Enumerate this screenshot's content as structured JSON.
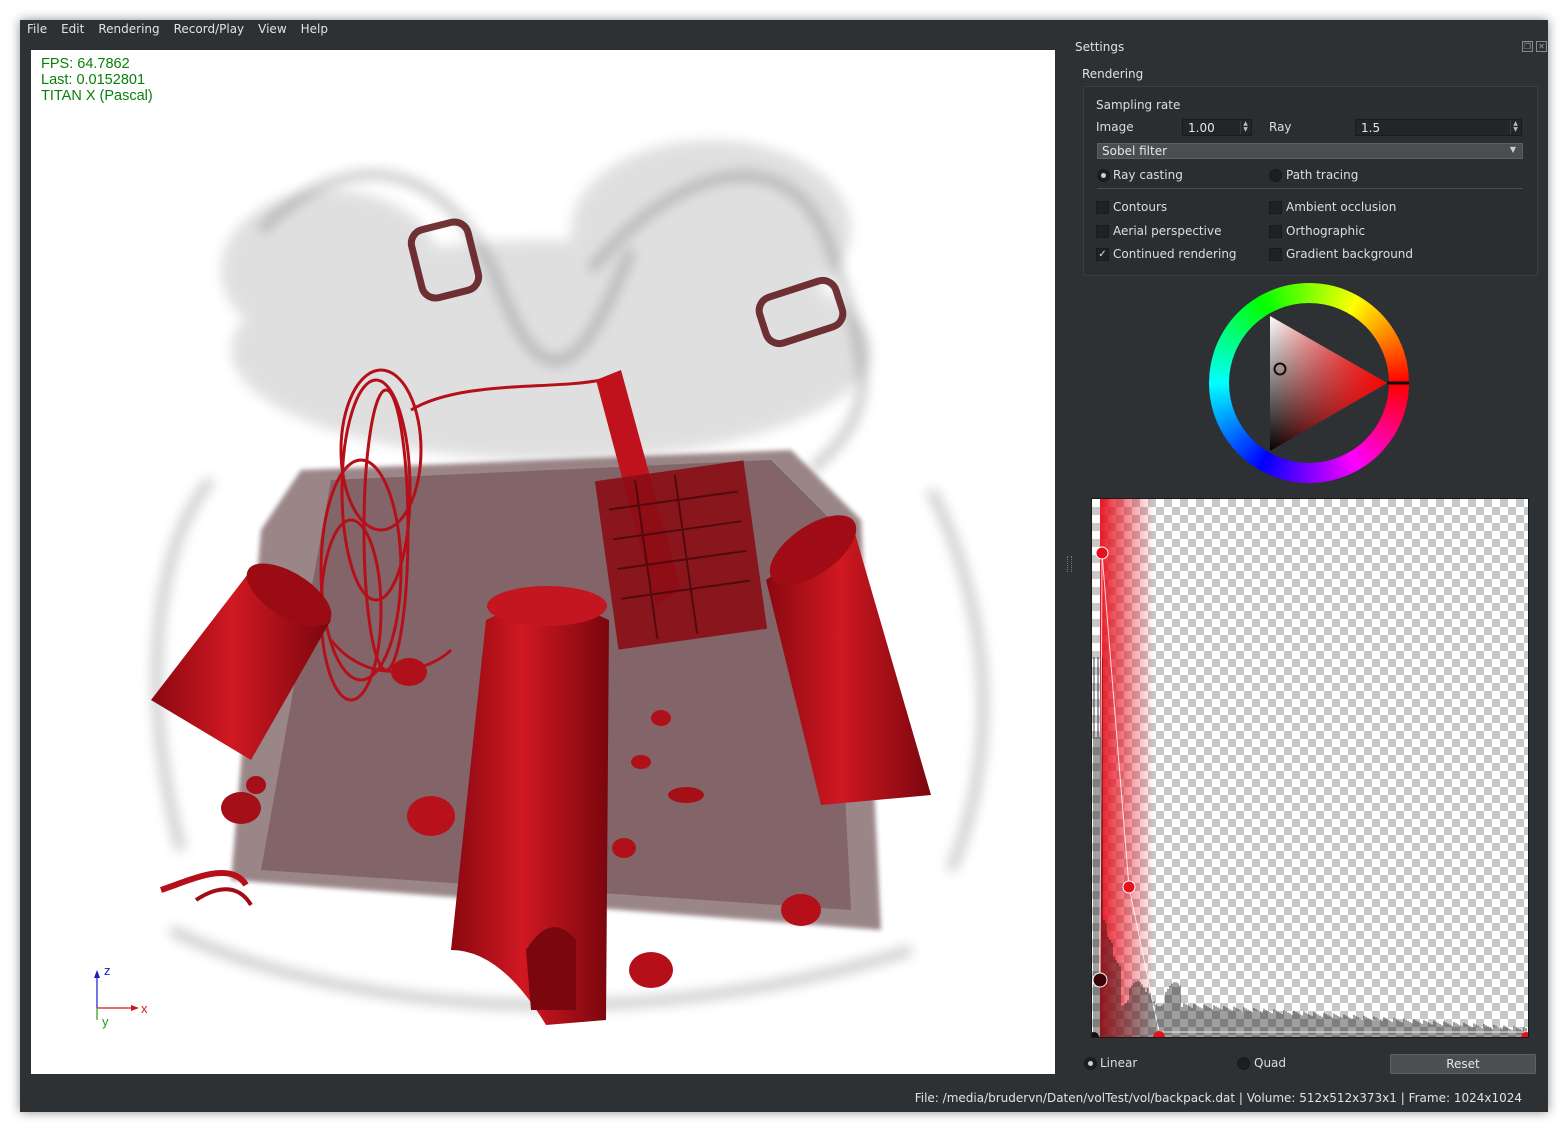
{
  "menubar": {
    "items": [
      "File",
      "Edit",
      "Rendering",
      "Record/Play",
      "View",
      "Help"
    ]
  },
  "viewport": {
    "fps_label": "FPS: 64.7862",
    "last_label": "Last: 0.0152801",
    "gpu_label": "TITAN X (Pascal)",
    "overlay_color": "#0a7f0a",
    "axes": {
      "z": "z",
      "x": "x",
      "y": "y"
    },
    "volume_color": "#c0101a"
  },
  "settings": {
    "dock_title": "Settings",
    "group_title": "Rendering",
    "sampling_rate_label": "Sampling rate",
    "image_label": "Image",
    "image_value": "1.00",
    "ray_label": "Ray",
    "ray_value": "1.5",
    "filter_value": "Sobel filter",
    "mode_options": [
      {
        "label": "Ray casting",
        "checked": true
      },
      {
        "label": "Path tracing",
        "checked": false
      }
    ],
    "checkboxes": [
      {
        "label": "Contours",
        "checked": false
      },
      {
        "label": "Ambient occlusion",
        "checked": false
      },
      {
        "label": "Aerial perspective",
        "checked": false
      },
      {
        "label": "Orthographic",
        "checked": false
      },
      {
        "label": "Continued rendering",
        "checked": true
      },
      {
        "label": "Gradient background",
        "checked": false
      }
    ]
  },
  "color_picker": {
    "selected_hue_color": "#ff0000"
  },
  "transfer_function": {
    "interpolation_options": [
      {
        "label": "Linear",
        "checked": true
      },
      {
        "label": "Quad",
        "checked": false
      }
    ],
    "reset_label": "Reset",
    "point_color": "#e8101e"
  },
  "statusbar": {
    "text": "File: /media/brudervn/Daten/volTest/vol/backpack.dat | Volume: 512x512x373x1 | Frame: 1024x1024"
  }
}
